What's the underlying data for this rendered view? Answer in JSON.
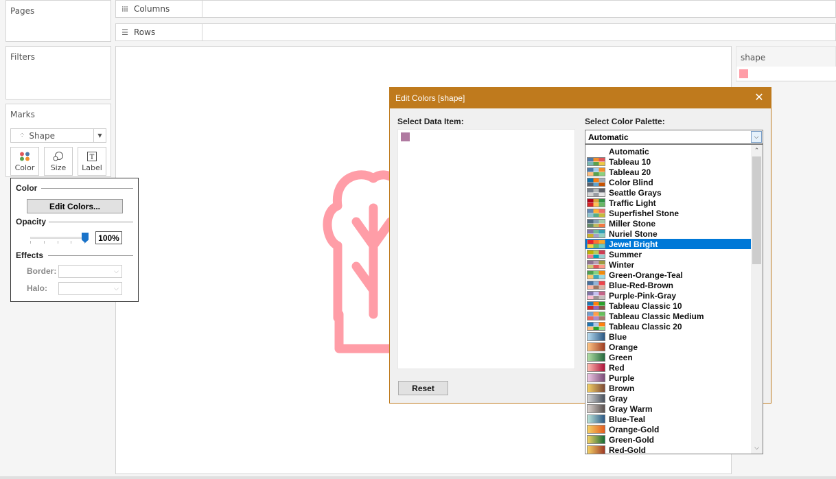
{
  "left_panel": {
    "pages_title": "Pages",
    "filters_title": "Filters",
    "marks_title": "Marks",
    "mark_type": "Shape",
    "mark_buttons": {
      "color": "Color",
      "size": "Size",
      "label": "Label"
    }
  },
  "shelves": {
    "columns": "Columns",
    "rows": "Rows"
  },
  "legend": {
    "title": "shape",
    "swatch_color": "#ff9da7"
  },
  "color_popup": {
    "color_heading": "Color",
    "edit_colors_button": "Edit Colors...",
    "opacity_heading": "Opacity",
    "opacity_value": "100%",
    "opacity_fraction": 1.0,
    "effects_heading": "Effects",
    "border_label": "Border:",
    "halo_label": "Halo:"
  },
  "canvas": {
    "shape_color": "#ff9da7",
    "shape_icon": "tree-icon"
  },
  "dialog": {
    "title": "Edit Colors [shape]",
    "data_item_label": "Select Data Item:",
    "palette_label": "Select Color Palette:",
    "data_item_swatch_color": "#b07aa1",
    "selected_palette": "Automatic",
    "reset_button": "Reset",
    "accent_color": "#bf7a1d"
  },
  "palettes": [
    {
      "name": "Automatic",
      "colors": []
    },
    {
      "name": "Tableau 10",
      "colors": [
        "#4e79a7",
        "#f28e2b",
        "#e15759",
        "#76b7b2",
        "#59a14f",
        "#edc948"
      ]
    },
    {
      "name": "Tableau 20",
      "colors": [
        "#4e79a7",
        "#a0cbe8",
        "#f28e2b",
        "#ffbe7d",
        "#59a14f",
        "#8cd17d"
      ]
    },
    {
      "name": "Color Blind",
      "colors": [
        "#1170aa",
        "#fc7d0b",
        "#a3acb9",
        "#57606c",
        "#5fa2ce",
        "#c85200"
      ]
    },
    {
      "name": "Seattle Grays",
      "colors": [
        "#767f8b",
        "#b3b7b8",
        "#5c6068",
        "#d3d3d3",
        "#989ca3",
        "#e8e8e8"
      ]
    },
    {
      "name": "Traffic Light",
      "colors": [
        "#b10318",
        "#dba13a",
        "#309343",
        "#d82526",
        "#ffc156",
        "#69b764"
      ]
    },
    {
      "name": "Superfishel Stone",
      "colors": [
        "#6388b4",
        "#ffae34",
        "#ef6f6a",
        "#8cc2ca",
        "#55ad89",
        "#c3bc3f"
      ]
    },
    {
      "name": "Miller Stone",
      "colors": [
        "#4f6980",
        "#849db1",
        "#a2ceaa",
        "#638b66",
        "#bfbb60",
        "#f47942"
      ]
    },
    {
      "name": "Nuriel Stone",
      "colors": [
        "#8175aa",
        "#6fb899",
        "#31a1b3",
        "#ccb22b",
        "#a39fc9",
        "#94d0c0"
      ]
    },
    {
      "name": "Jewel Bright",
      "colors": [
        "#eb1e2c",
        "#fd6f30",
        "#f9a729",
        "#f9d23c",
        "#5fbb68",
        "#64cdcc"
      ]
    },
    {
      "name": "Summer",
      "colors": [
        "#bfb202",
        "#b9ca5d",
        "#cf3e53",
        "#f1788d",
        "#00a2b3",
        "#97cfd0"
      ]
    },
    {
      "name": "Winter",
      "colors": [
        "#90728f",
        "#b9a0b4",
        "#9d983d",
        "#cecb76",
        "#e15759",
        "#ff9888"
      ]
    },
    {
      "name": "Green-Orange-Teal",
      "colors": [
        "#4e9f50",
        "#87d180",
        "#ef8a0c",
        "#fcc66d",
        "#3ca8bc",
        "#98d9e4"
      ]
    },
    {
      "name": "Blue-Red-Brown",
      "colors": [
        "#466f9d",
        "#91b3d7",
        "#ed444a",
        "#feb5a2",
        "#9d7660",
        "#d7b5a6"
      ]
    },
    {
      "name": "Purple-Pink-Gray",
      "colors": [
        "#8074a8",
        "#c6c1f0",
        "#c46487",
        "#ffbed1",
        "#9c9290",
        "#c5bfbe"
      ]
    },
    {
      "name": "Tableau Classic 10",
      "colors": [
        "#1f77b4",
        "#ff7f0e",
        "#2ca02c",
        "#d62728",
        "#9467bd",
        "#8c564b"
      ]
    },
    {
      "name": "Tableau Classic Medium",
      "colors": [
        "#729ece",
        "#ff9e4a",
        "#67bf5c",
        "#ed665d",
        "#ad8bc9",
        "#a8786e"
      ]
    },
    {
      "name": "Tableau Classic 20",
      "colors": [
        "#1f77b4",
        "#aec7e8",
        "#ff7f0e",
        "#ffbb78",
        "#2ca02c",
        "#98df8a"
      ]
    },
    {
      "name": "Blue",
      "colors": [
        "#b9ddf1",
        "#2a5783"
      ]
    },
    {
      "name": "Orange",
      "colors": [
        "#ffc685",
        "#9e3d22"
      ]
    },
    {
      "name": "Green",
      "colors": [
        "#b3e0a6",
        "#24693d"
      ]
    },
    {
      "name": "Red",
      "colors": [
        "#ffbeb2",
        "#ae123a"
      ]
    },
    {
      "name": "Purple",
      "colors": [
        "#eec9e5",
        "#7c4d79"
      ]
    },
    {
      "name": "Brown",
      "colors": [
        "#f4d166",
        "#7e4a35"
      ]
    },
    {
      "name": "Gray",
      "colors": [
        "#d5d5d5",
        "#49525e"
      ]
    },
    {
      "name": "Gray Warm",
      "colors": [
        "#dcd4d0",
        "#59504e"
      ]
    },
    {
      "name": "Blue-Teal",
      "colors": [
        "#bce4d8",
        "#2c5985"
      ]
    },
    {
      "name": "Orange-Gold",
      "colors": [
        "#f4d166",
        "#e35c1e"
      ]
    },
    {
      "name": "Green-Gold",
      "colors": [
        "#f4d166",
        "#146c36"
      ]
    },
    {
      "name": "Red-Gold",
      "colors": [
        "#f4d166",
        "#9e3a26"
      ]
    }
  ],
  "selected_index": 9
}
